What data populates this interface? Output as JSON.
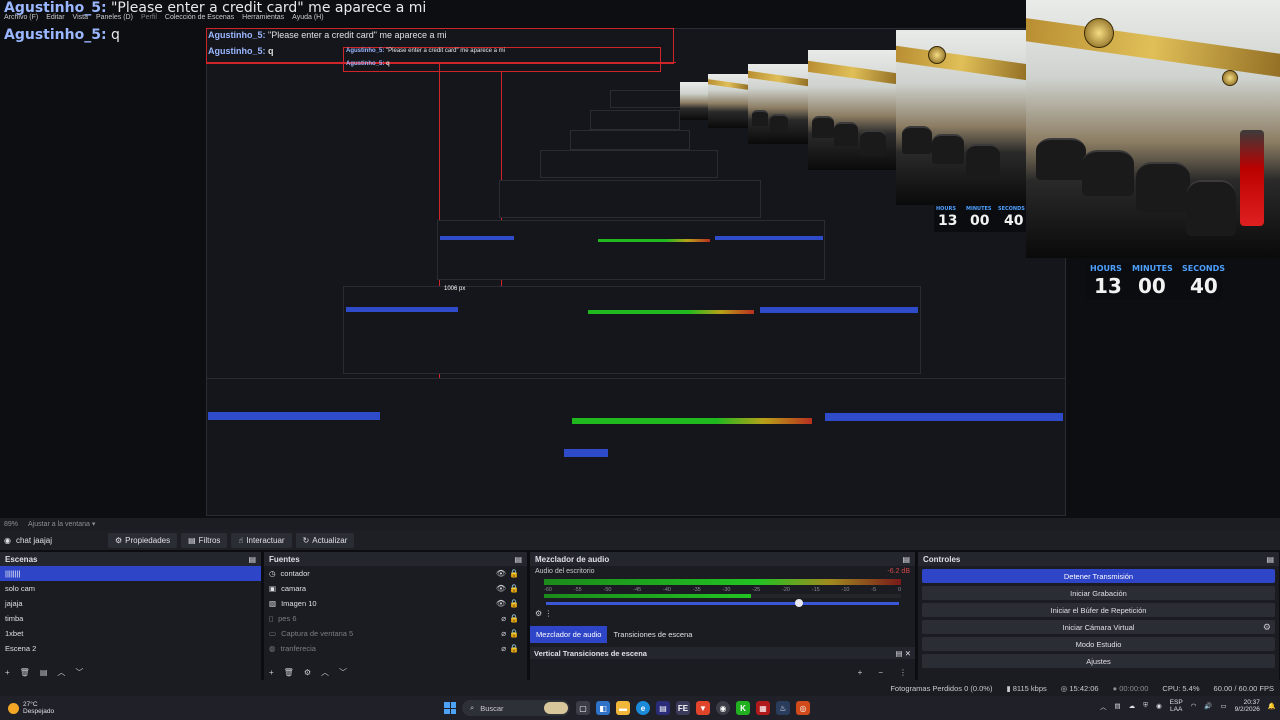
{
  "chat": {
    "line1_user": "Agustinho_5:",
    "line1_text": " \"Please enter a credit card\" me aparece a mi",
    "line2_user": "Agustinho_5:",
    "line2_text": " q"
  },
  "menubar": {
    "items": [
      "Archivo (F)",
      "Editar",
      "Vista",
      "Paneles (D)",
      "Perfil",
      "Colección de Escenas",
      "Herramientas",
      "Ayuda (H)"
    ]
  },
  "preview": {
    "px_label": "1006 px",
    "timers": [
      {
        "hours_label": "HOURS",
        "minutes_label": "MINUTES",
        "seconds_label": "SECONDS",
        "hours": "13",
        "minutes": "00",
        "seconds": "40"
      },
      {
        "hours_label": "HOURS",
        "minutes_label": "MINUTES",
        "seconds_label": "SECONDS",
        "hours": "13",
        "minutes": "00",
        "seconds": "40"
      }
    ]
  },
  "toolbar": {
    "zoom": "89%",
    "fit": "Ajustar a la ventana"
  },
  "sourcebar": {
    "selected": "chat jaajaj",
    "properties": "Propiedades",
    "filters": "Filtros",
    "interact": "Interactuar",
    "refresh": "Actualizar"
  },
  "scenes": {
    "title": "Escenas",
    "items": [
      "||||||||",
      "solo cam",
      "jajaja",
      "timba",
      "1xbet",
      "Escena 2"
    ]
  },
  "sources": {
    "title": "Fuentes",
    "items": [
      {
        "name": "contador",
        "dim": false
      },
      {
        "name": "camara",
        "dim": false
      },
      {
        "name": "Imagen 10",
        "dim": false
      },
      {
        "name": "pes 6",
        "dim": true
      },
      {
        "name": "Captura de ventana 5",
        "dim": true
      },
      {
        "name": "tranferecia",
        "dim": true
      }
    ]
  },
  "mixer": {
    "title": "Mezclador de audio",
    "channel": "Audio del escritorio",
    "db": "-6.2 dB",
    "ticks": [
      "-60",
      "-55",
      "-50",
      "-45",
      "-40",
      "-35",
      "-30",
      "-25",
      "-20",
      "-15",
      "-10",
      "-5",
      "0"
    ],
    "tab_mixer": "Mezclador de audio",
    "tab_transitions": "Transiciones de escena",
    "vertical_title": "Vertical Transiciones de escena",
    "volume_fraction": 0.6
  },
  "controls": {
    "title": "Controles",
    "buttons": [
      "Detener Transmisión",
      "Iniciar Grabación",
      "Iniciar el Búfer de Repetición",
      "Iniciar Cámara Virtual",
      "Modo Estudio",
      "Ajustes"
    ]
  },
  "status": {
    "dropped": "Fotogramas Perdidos 0 (0.0%)",
    "bitrate": "8115 kbps",
    "live_time": "15:42:06",
    "rec_time": "00:00:00",
    "cpu": "CPU: 5.4%",
    "fps": "60.00 / 60.00 FPS"
  },
  "taskbar": {
    "temp": "27°C",
    "weather": "Despejado",
    "search": "Buscar",
    "lang1": "ESP",
    "lang2": "LAA",
    "time": "20:37",
    "date": "9/2/2026"
  },
  "colors": {
    "accent": "#2e45c7",
    "timer_label": "#4ea0ff",
    "highlight_red": "#d0242b"
  }
}
